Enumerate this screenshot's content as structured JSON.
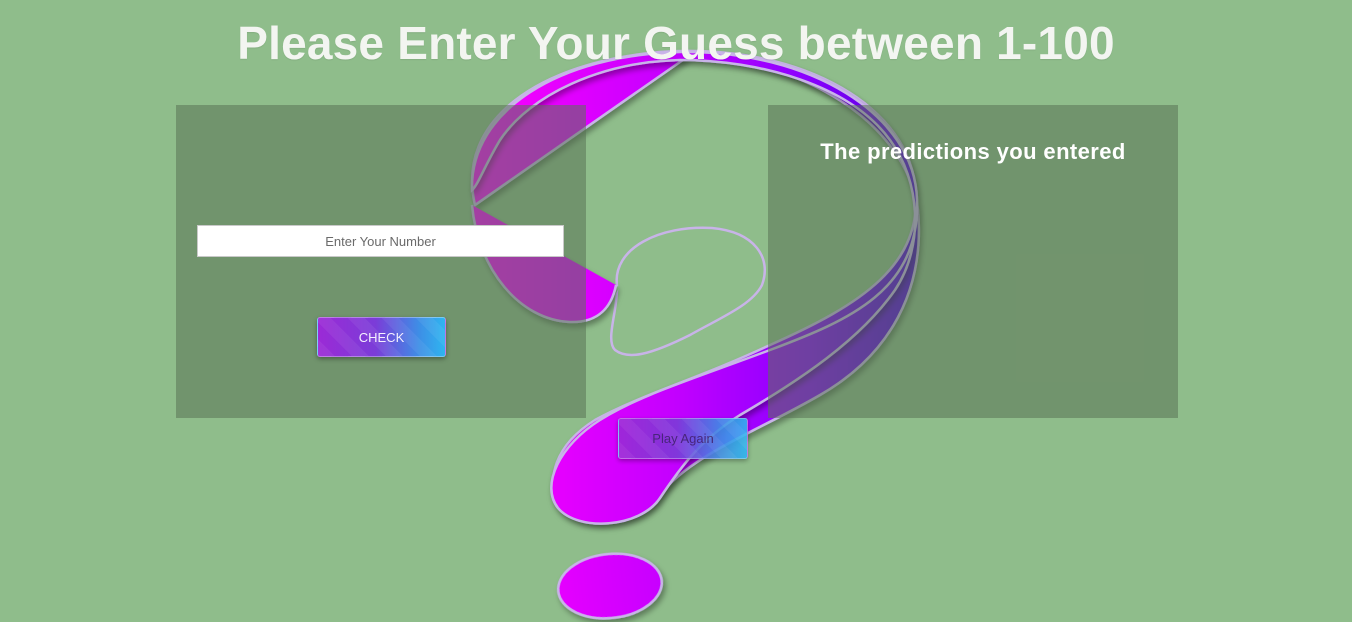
{
  "header": {
    "title": "Please Enter Your Guess between 1-100"
  },
  "input_panel": {
    "number_input": {
      "placeholder": "Enter Your Number",
      "value": ""
    },
    "check_label": "CHECK"
  },
  "predictions_panel": {
    "title": "The predictions you entered",
    "entries": []
  },
  "play_again_label": "Play Again",
  "background_image": {
    "icon": "question-mark-icon",
    "gradient_colors": [
      "#ff00ff",
      "#c400ff",
      "#8a00ff",
      "#4a00d6"
    ]
  },
  "colors": {
    "background": "#8fbd8b",
    "panel": "#73956f",
    "button_gradient_start": "#9b2ad6",
    "button_gradient_end": "#2fb5f0"
  }
}
